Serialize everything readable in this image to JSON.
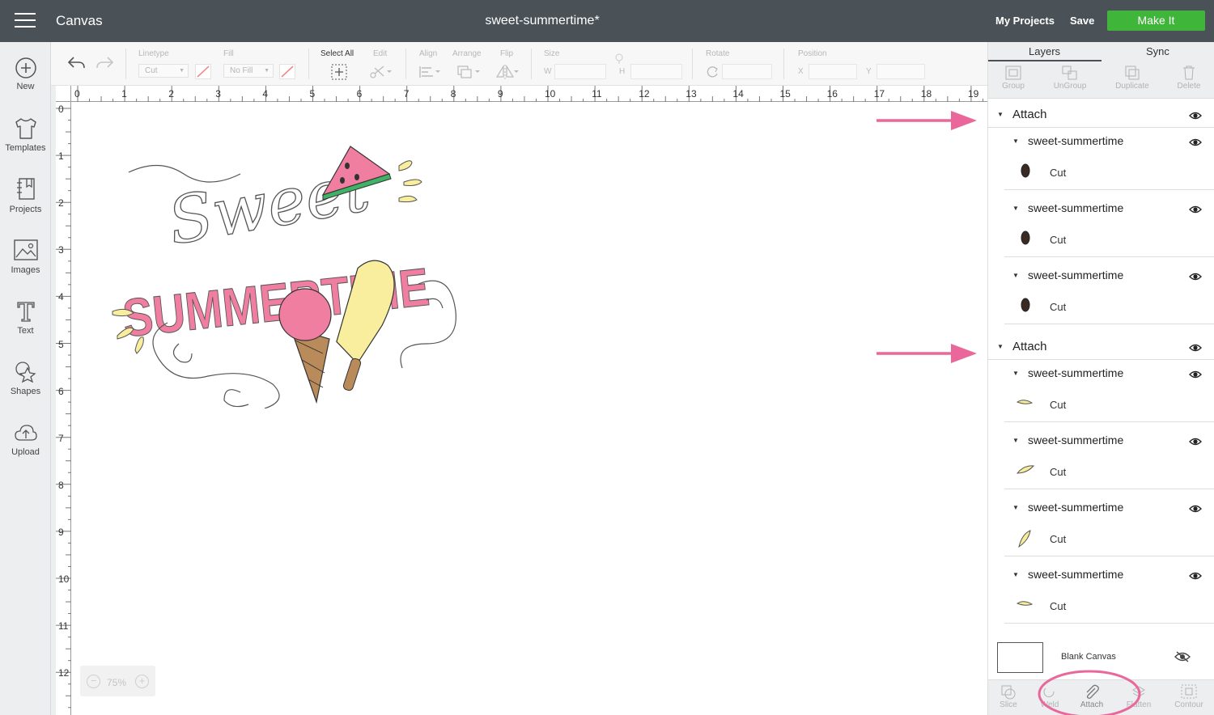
{
  "header": {
    "app_title": "Canvas",
    "document_title": "sweet-summertime*",
    "my_projects": "My Projects",
    "save": "Save",
    "make_it": "Make It"
  },
  "sidebar": {
    "items": [
      {
        "label": "New",
        "icon": "plus-circle-icon"
      },
      {
        "label": "Templates",
        "icon": "tshirt-icon"
      },
      {
        "label": "Projects",
        "icon": "book-icon"
      },
      {
        "label": "Images",
        "icon": "image-icon"
      },
      {
        "label": "Text",
        "icon": "text-icon"
      },
      {
        "label": "Shapes",
        "icon": "shapes-icon"
      },
      {
        "label": "Upload",
        "icon": "cloud-upload-icon"
      }
    ]
  },
  "toolbar": {
    "linetype_label": "Linetype",
    "linetype_value": "Cut",
    "fill_label": "Fill",
    "fill_value": "No Fill",
    "select_all": "Select All",
    "edit": "Edit",
    "align": "Align",
    "arrange": "Arrange",
    "flip": "Flip",
    "size": "Size",
    "size_w": "W",
    "size_h": "H",
    "rotate": "Rotate",
    "position": "Position",
    "position_x": "X",
    "position_y": "Y"
  },
  "rulers": {
    "horizontal": [
      "0",
      "1",
      "2",
      "3",
      "4",
      "5",
      "6",
      "7",
      "8",
      "9",
      "10",
      "11",
      "12",
      "13",
      "14",
      "15",
      "16",
      "17",
      "18",
      "19"
    ],
    "vertical": [
      "0",
      "1",
      "2",
      "3",
      "4",
      "5",
      "6",
      "7",
      "8",
      "9",
      "10",
      "11",
      "12"
    ]
  },
  "zoom": {
    "minus": "−",
    "value": "75%",
    "plus": "+"
  },
  "panel": {
    "tabs": [
      "Layers",
      "Sync"
    ],
    "actions": [
      "Group",
      "UnGroup",
      "Duplicate",
      "Delete"
    ],
    "groups": [
      {
        "label": "Attach",
        "layers": [
          {
            "name": "sweet-summertime",
            "cut": "Cut",
            "swatch": "#3a2a22",
            "shape": "seed"
          },
          {
            "name": "sweet-summertime",
            "cut": "Cut",
            "swatch": "#3a2a22",
            "shape": "seed"
          },
          {
            "name": "sweet-summertime",
            "cut": "Cut",
            "swatch": "#3a2a22",
            "shape": "seed"
          }
        ]
      },
      {
        "label": "Attach",
        "layers": [
          {
            "name": "sweet-summertime",
            "cut": "Cut",
            "swatch": "#f6ec9a",
            "shape": "drop-flat"
          },
          {
            "name": "sweet-summertime",
            "cut": "Cut",
            "swatch": "#f6ec9a",
            "shape": "drop-tilt"
          },
          {
            "name": "sweet-summertime",
            "cut": "Cut",
            "swatch": "#f6ec9a",
            "shape": "drop-tall"
          },
          {
            "name": "sweet-summertime",
            "cut": "Cut",
            "swatch": "#f6ec9a",
            "shape": "drop-flat"
          }
        ]
      }
    ],
    "blank_canvas": "Blank Canvas",
    "bottom_actions": [
      "Slice",
      "Weld",
      "Attach",
      "Flatten",
      "Contour"
    ]
  },
  "artwork": {
    "script_word": "Sweet",
    "block_word": "SUMMERTIME",
    "pink": "#ef7ea0",
    "yellow": "#f8ee9e",
    "green": "#3fb265",
    "brown": "#b98a5a"
  },
  "annotation_color": "#e9679a"
}
